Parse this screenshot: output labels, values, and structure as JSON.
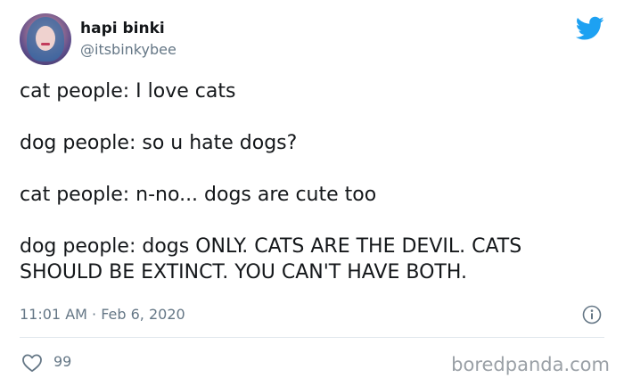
{
  "user": {
    "display_name": "hapi binki",
    "handle": "@itsbinkybee"
  },
  "tweet": {
    "lines": [
      "cat people: I love cats",
      "dog people: so u hate dogs?",
      "cat people: n-no... dogs are cute too",
      "dog people: dogs ONLY. CATS ARE THE DEVIL. CATS SHOULD BE EXTINCT. YOU CAN'T HAVE BOTH."
    ],
    "timestamp": "11:01 AM · Feb 6, 2020",
    "like_count": "99"
  },
  "watermark": "boredpanda.com",
  "icons": {
    "logo": "twitter-bird-icon",
    "info": "info-icon",
    "like": "heart-icon"
  },
  "colors": {
    "twitter_blue": "#1da1f2",
    "secondary_text": "#657786",
    "primary_text": "#14171a",
    "divider": "#e1e8ed"
  }
}
